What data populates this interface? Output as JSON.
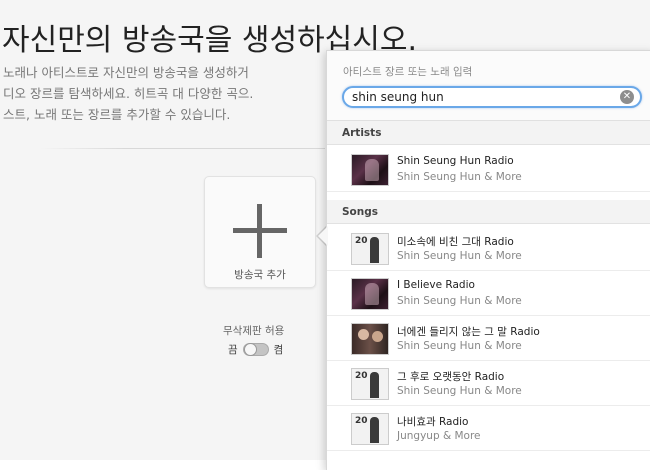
{
  "page": {
    "title": "자신만의 방송국을 생성하십시오.",
    "description_lines": [
      "노래나 아티스트로 자신만의 방송국을 생성하거",
      "디오 장르를 탐색하세요. 히트곡 대 다양한 곡으.",
      "스트, 노래 또는 장르를 추가할 수 있습니다."
    ],
    "add_station_label": "방송국 추가",
    "explicit_label": "무삭제판 허용",
    "toggle_off_label": "끔",
    "toggle_on_label": "켬"
  },
  "search": {
    "prompt": "아티스트 장르 또는 노래 입력",
    "value": "shin seung hun",
    "clear_glyph": "✕"
  },
  "sections": {
    "artists_label": "Artists",
    "songs_label": "Songs"
  },
  "artists": [
    {
      "title": "Shin Seung Hun Radio",
      "subtitle": "Shin Seung Hun & More",
      "art": "dark"
    }
  ],
  "songs": [
    {
      "title": "미소속에 비친 그대 Radio",
      "subtitle": "Shin Seung Hun & More",
      "art": "light"
    },
    {
      "title": "I Believe Radio",
      "subtitle": "Shin Seung Hun & More",
      "art": "dark"
    },
    {
      "title": "너에겐 들리지 않는 그 말 Radio",
      "subtitle": "Shin Seung Hun & More",
      "art": "duo"
    },
    {
      "title": "그 후로 오랫동안 Radio",
      "subtitle": "Shin Seung Hun & More",
      "art": "light"
    },
    {
      "title": "나비효과 Radio",
      "subtitle": "Jungyup & More",
      "art": "light"
    }
  ],
  "colors": {
    "search_focus": "#6aa8e8",
    "section_bg": "#f3f3f3"
  }
}
